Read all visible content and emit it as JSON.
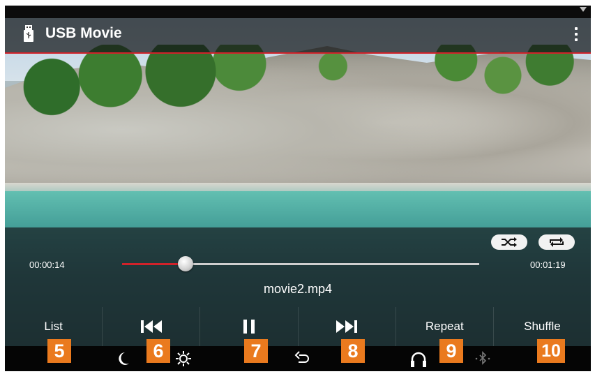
{
  "app": {
    "title": "USB Movie"
  },
  "player": {
    "elapsed": "00:00:14",
    "total": "00:01:19",
    "progress": 0.177,
    "filename": "movie2.mp4"
  },
  "controls": {
    "list_label": "List",
    "repeat_label": "Repeat",
    "shuffle_label": "Shuffle"
  },
  "callouts": [
    "5",
    "6",
    "7",
    "8",
    "9",
    "10"
  ],
  "colors": {
    "accent": "#d1222a",
    "callout": "#ea7a1e"
  },
  "icons": {
    "titlebar": "usb-icon",
    "menu": "more-vertical-icon",
    "modes": [
      "shuffle-icon",
      "repeat-icon"
    ],
    "playback": [
      "previous-track-icon",
      "pause-icon",
      "next-track-icon"
    ],
    "system": [
      "night-mode-icon",
      "brightness-icon",
      "back-icon",
      "headphone-icon",
      "bluetooth-icon"
    ]
  }
}
